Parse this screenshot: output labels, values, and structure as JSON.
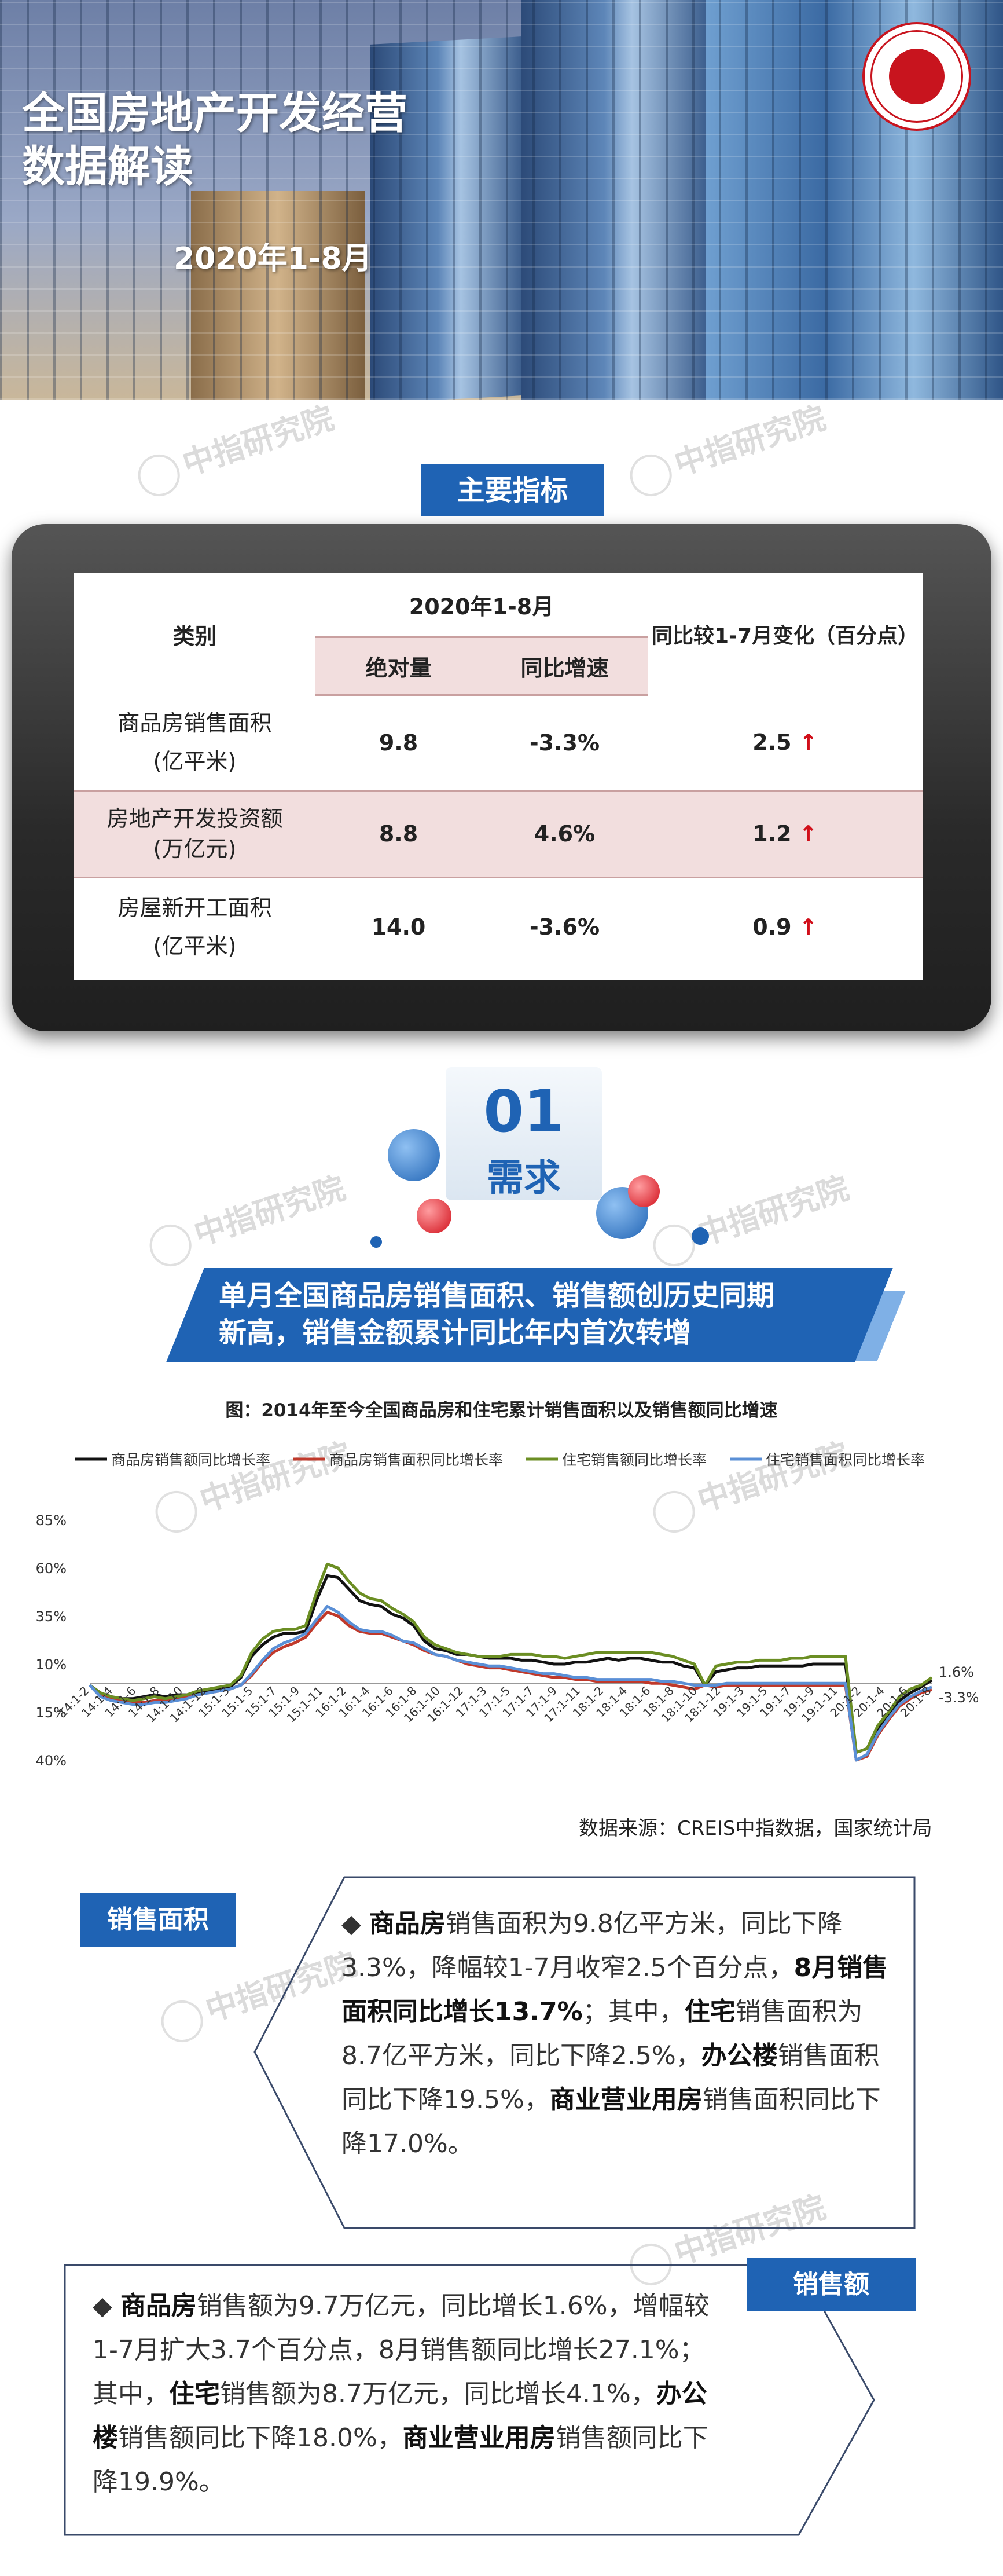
{
  "hero": {
    "title_line1": "全国房地产开发经营",
    "title_line2": "数据解读",
    "date": "2020年1-8月"
  },
  "watermark": "中指研究院",
  "section_main": {
    "label": "主要指标"
  },
  "table": {
    "col_category": "类别",
    "col_period": "2020年1-8月",
    "col_abs": "绝对量",
    "col_yoy": "同比增速",
    "col_change": "同比较1-7月变化（百分点）",
    "rows": [
      {
        "name_line1": "商品房销售面积",
        "name_line2": "(亿平米)",
        "abs": "9.8",
        "yoy": "-3.3%",
        "change": "2.5"
      },
      {
        "name_line1": "房地产开发投资额",
        "name_line2": "(万亿元)",
        "abs": "8.8",
        "yoy": "4.6%",
        "change": "1.2"
      },
      {
        "name_line1": "房屋新开工面积",
        "name_line2": "(亿平米)",
        "abs": "14.0",
        "yoy": "-3.6%",
        "change": "0.9"
      }
    ],
    "arrow": "↑"
  },
  "section01": {
    "num": "01",
    "label": "需求"
  },
  "banner": {
    "line1": "单月全国商品房销售面积、销售额创历史同期",
    "line2": "新高，销售金额累计同比年内首次转增"
  },
  "chart_title": "图：2014年至今全国商品房和住宅累计销售面积以及销售额同比增速",
  "chart_data": {
    "type": "line",
    "title": "图：2014年至今全国商品房和住宅累计销售面积以及销售额同比增速",
    "ylim": [
      -40,
      85
    ],
    "y_ticks": [
      "-40%",
      "-15%",
      "10%",
      "35%",
      "60%",
      "85%"
    ],
    "x_tick_labels": [
      "14:1-2",
      "14:1-4",
      "14:1-6",
      "14:1-8",
      "14:1-10",
      "14:1-12",
      "15:1-3",
      "15:1-5",
      "15:1-7",
      "15:1-9",
      "15:1-11",
      "16:1-2",
      "16:1-4",
      "16:1-6",
      "16:1-8",
      "16:1-10",
      "16:1-12",
      "17:1-3",
      "17:1-5",
      "17:1-7",
      "17:1-9",
      "17:1-11",
      "18:1-2",
      "18:1-4",
      "18:1-6",
      "18:1-8",
      "18:1-10",
      "18:1-12",
      "19:1-3",
      "19:1-5",
      "19:1-7",
      "19:1-9",
      "19:1-11",
      "20:1-2",
      "20:1-4",
      "20:1-6",
      "20:1-8"
    ],
    "series": [
      {
        "name": "商品房销售额同比增长率",
        "color": "#111111",
        "values": [
          -1,
          -5,
          -7,
          -8,
          -8,
          -7,
          -6,
          -7,
          -6,
          -6,
          -5,
          -4,
          -3,
          -2,
          3,
          14,
          20,
          24,
          26,
          26,
          27,
          43,
          56,
          55,
          49,
          43,
          41,
          40,
          36,
          34,
          30,
          22,
          18,
          17,
          15,
          15,
          14,
          13,
          13,
          13,
          12,
          12,
          11,
          10,
          10,
          11,
          11,
          12,
          13,
          12,
          13,
          13,
          12,
          11,
          11,
          9,
          8,
          -1,
          6,
          7,
          8,
          8,
          9,
          9,
          9,
          9,
          9,
          10,
          10,
          10,
          10,
          -36,
          -34,
          -24,
          -17,
          -9,
          -5,
          -2,
          1.6
        ]
      },
      {
        "name": "商品房销售面积同比增长率",
        "color": "#c0392b",
        "values": [
          -1,
          -6,
          -8,
          -9,
          -10,
          -10,
          -9,
          -9,
          -8,
          -7,
          -6,
          -5,
          -4,
          -3,
          -1,
          4,
          11,
          16,
          19,
          21,
          24,
          31,
          37,
          35,
          30,
          27,
          26,
          26,
          24,
          22,
          20,
          17,
          15,
          14,
          12,
          10,
          9,
          8,
          8,
          7,
          6,
          5,
          4,
          3,
          3,
          2,
          2,
          1,
          1,
          1,
          1,
          1,
          0,
          0,
          -1,
          -2,
          -3,
          -1,
          -2,
          -1,
          -1,
          -1,
          -1,
          -1,
          -1,
          -1,
          -1,
          -1,
          -1,
          -1,
          -1,
          -40,
          -38,
          -27,
          -19,
          -12,
          -8,
          -5,
          -3.3
        ]
      },
      {
        "name": "住宅销售额同比增长率",
        "color": "#6b8e23",
        "values": [
          -1,
          -5,
          -7,
          -8,
          -9,
          -8,
          -7,
          -8,
          -7,
          -6,
          -4,
          -3,
          -2,
          -1,
          4,
          16,
          23,
          27,
          28,
          28,
          30,
          47,
          62,
          60,
          53,
          47,
          44,
          43,
          39,
          36,
          32,
          24,
          20,
          18,
          16,
          15,
          14,
          14,
          14,
          15,
          15,
          15,
          14,
          14,
          13,
          14,
          15,
          16,
          16,
          16,
          16,
          16,
          16,
          15,
          14,
          12,
          10,
          -1,
          9,
          10,
          11,
          11,
          12,
          12,
          12,
          13,
          13,
          14,
          14,
          14,
          14,
          -36,
          -34,
          -22,
          -15,
          -7,
          -3,
          -1,
          3
        ]
      },
      {
        "name": "住宅销售面积同比增长率",
        "color": "#5a8fd6",
        "values": [
          -1,
          -7,
          -9,
          -10,
          -11,
          -11,
          -10,
          -10,
          -9,
          -8,
          -6,
          -5,
          -4,
          -3,
          -1,
          5,
          12,
          18,
          21,
          23,
          26,
          33,
          40,
          37,
          32,
          28,
          27,
          27,
          25,
          22,
          21,
          18,
          15,
          14,
          12,
          11,
          10,
          9,
          9,
          8,
          7,
          6,
          5,
          5,
          4,
          3,
          3,
          2,
          2,
          2,
          2,
          2,
          2,
          1,
          1,
          0,
          -1,
          -1,
          -1,
          0,
          0,
          0,
          0,
          0,
          0,
          0,
          0,
          0,
          0,
          0,
          0,
          -40,
          -37,
          -26,
          -18,
          -11,
          -7,
          -4,
          -2
        ]
      }
    ],
    "end_labels": [
      "1.6%",
      "-3.3%"
    ]
  },
  "chart_source": "数据来源：CREIS中指数据，国家统计局",
  "sales_area": {
    "label": "销售面积",
    "p1": "商品房",
    "p2": "销售面积为9.8亿平方米，同比下降3.3%，降幅较1-7月收窄2.5个百分点，",
    "p3": "8月销售面积同比增长13.7%",
    "p4": "；其中，",
    "p5": "住宅",
    "p6": "销售面积为8.7亿平方米，同比下降2.5%，",
    "p7": "办公楼",
    "p8": "销售面积同比下降19.5%，",
    "p9": "商业营业用房",
    "p10": "销售面积同比下降17.0%。"
  },
  "sales_amount": {
    "label": "销售额",
    "p1": "商品房",
    "p2": "销售额为9.7万亿元，同比增长1.6%，增幅较1-7月扩大3.7个百分点，8月销售额同比增长27.1%；其中，",
    "p3": "住宅",
    "p4": "销售额为8.7万亿元，同比增长4.1%，",
    "p5": "办公楼",
    "p6": "销售额同比下降18.0%，",
    "p7": "商业营业用房",
    "p8": "销售额同比下降19.9%。"
  }
}
